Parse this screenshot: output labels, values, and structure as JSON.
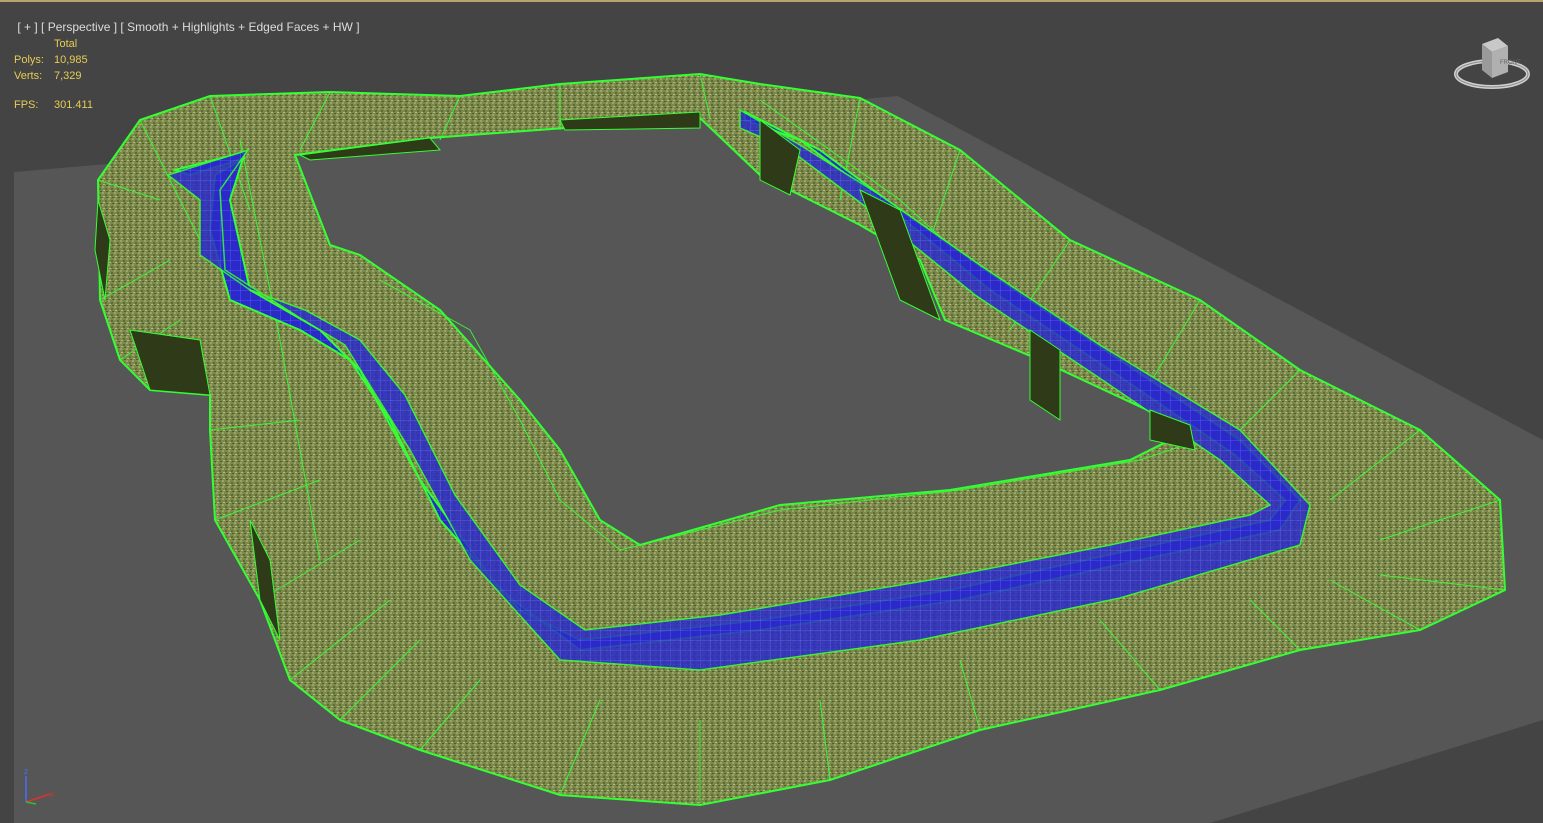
{
  "viewport": {
    "label_plus": "[ + ]",
    "label_view": "[ Perspective ]",
    "label_shading": "[ Smooth + Highlights + Edged Faces + HW ]"
  },
  "stats": {
    "header": "Total",
    "polys_label": "Polys:",
    "polys_value": "10,985",
    "verts_label": "Verts:",
    "verts_value": "7,329",
    "fps_label": "FPS:",
    "fps_value": "301.411"
  },
  "viewcube": {
    "face_label": "FRONT"
  },
  "axis": {
    "z": "z",
    "x": "x"
  },
  "colors": {
    "background": "#444444",
    "ground_plane": "#565656",
    "wire_green": "#33ff33",
    "road_blue": "#2a27c4",
    "terrain": "#7d8a4c",
    "stats_text": "#e6cc54"
  },
  "icons": [
    "viewcube-icon",
    "axis-tripod-icon"
  ]
}
